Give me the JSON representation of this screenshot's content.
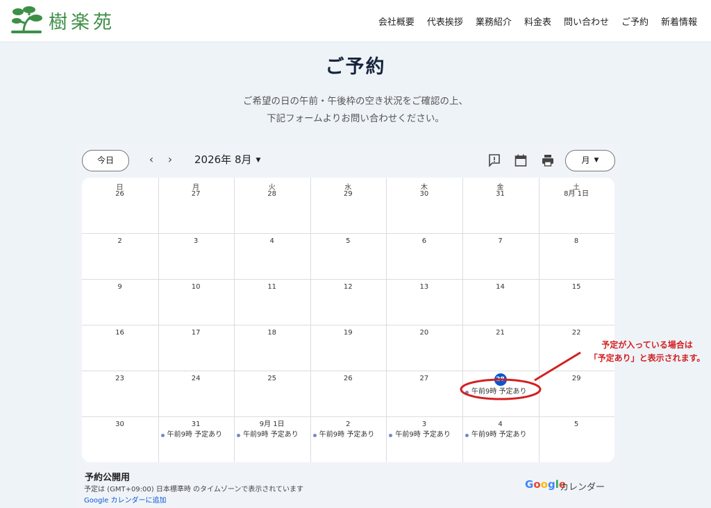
{
  "site": {
    "logo_text": "樹楽苑",
    "nav": [
      "会社概要",
      "代表挨拶",
      "業務紹介",
      "料金表",
      "問い合わせ",
      "ご予約",
      "新着情報"
    ]
  },
  "page": {
    "title": "ご予約",
    "intro_line1": "ご希望の日の午前・午後枠の空き状況をご確認の上、",
    "intro_line2": "下記フォームよりお問い合わせください。"
  },
  "calendar": {
    "today_label": "今日",
    "prev_icon": "chevron-left-icon",
    "next_icon": "chevron-right-icon",
    "month_label": "2026年 8月",
    "view_label": "月",
    "weekdays": [
      "日",
      "月",
      "火",
      "水",
      "木",
      "金",
      "土"
    ],
    "weeks": [
      [
        {
          "d": "26"
        },
        {
          "d": "27"
        },
        {
          "d": "28"
        },
        {
          "d": "29"
        },
        {
          "d": "30"
        },
        {
          "d": "31"
        },
        {
          "d": "8月 1日"
        }
      ],
      [
        {
          "d": "2"
        },
        {
          "d": "3"
        },
        {
          "d": "4"
        },
        {
          "d": "5"
        },
        {
          "d": "6"
        },
        {
          "d": "7"
        },
        {
          "d": "8"
        }
      ],
      [
        {
          "d": "9"
        },
        {
          "d": "10"
        },
        {
          "d": "11"
        },
        {
          "d": "12"
        },
        {
          "d": "13"
        },
        {
          "d": "14"
        },
        {
          "d": "15"
        }
      ],
      [
        {
          "d": "16"
        },
        {
          "d": "17"
        },
        {
          "d": "18"
        },
        {
          "d": "19"
        },
        {
          "d": "20"
        },
        {
          "d": "21"
        },
        {
          "d": "22"
        }
      ],
      [
        {
          "d": "23"
        },
        {
          "d": "24"
        },
        {
          "d": "25"
        },
        {
          "d": "26"
        },
        {
          "d": "27"
        },
        {
          "d": "28",
          "today": true,
          "event": "午前9時 予定あり"
        },
        {
          "d": "29"
        }
      ],
      [
        {
          "d": "30"
        },
        {
          "d": "31",
          "event": "午前9時 予定あり"
        },
        {
          "d": "9月 1日",
          "event": "午前9時 予定あり"
        },
        {
          "d": "2",
          "event": "午前9時 予定あり"
        },
        {
          "d": "3",
          "event": "午前9時 予定あり"
        },
        {
          "d": "4",
          "event": "午前9時 予定あり"
        },
        {
          "d": "5"
        }
      ]
    ],
    "footer_title": "予約公開用",
    "timezone_note": "予定は (GMT+09:00) 日本標準時 のタイムゾーンで表示されています",
    "add_link": "Google カレンダーに追加",
    "brand_google": "Google",
    "brand_calendar": "カレンダー",
    "colors": {
      "today": "#0b57d0",
      "event_dot": "#7986cb",
      "annotation": "#d32020"
    }
  },
  "annotation": {
    "line1": "予定が入っている場合は",
    "line2": "「予定あり」と表示されます。"
  }
}
